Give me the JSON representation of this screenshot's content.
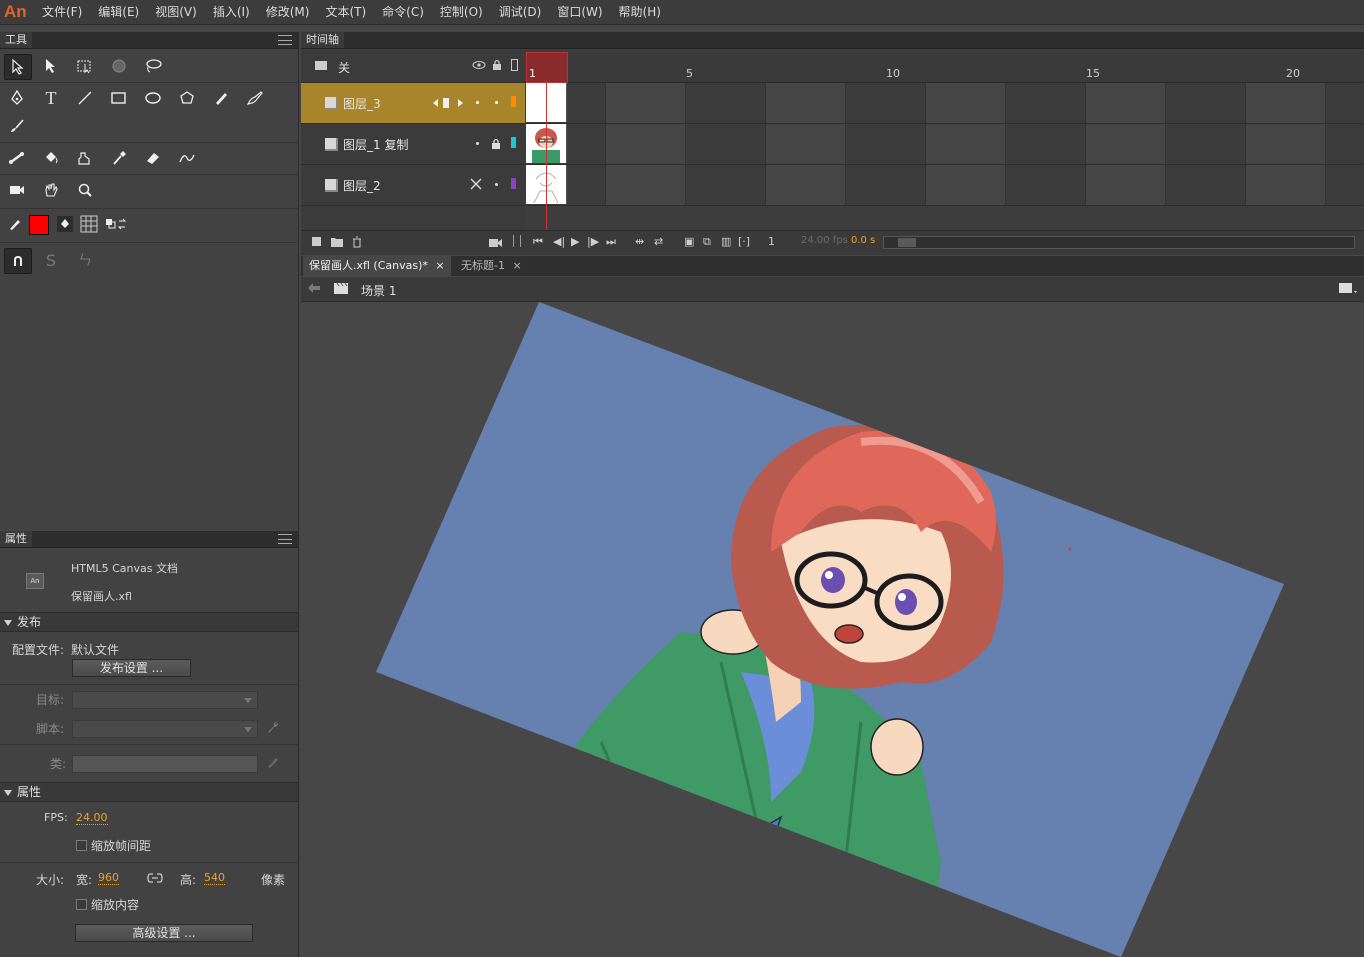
{
  "app": {
    "logo": "An"
  },
  "menu": [
    "文件(F)",
    "编辑(E)",
    "视图(V)",
    "插入(I)",
    "修改(M)",
    "文本(T)",
    "命令(C)",
    "控制(O)",
    "调试(D)",
    "窗口(W)",
    "帮助(H)"
  ],
  "tools_panel": {
    "title": "工具"
  },
  "colors": {
    "stroke": "#222222",
    "fill": "#ff0000",
    "accent": "#e8a427",
    "active_layer": "#a8842a",
    "stage_bg": "#6681b0"
  },
  "timeline": {
    "title": "时间轴",
    "header_row_label": "关",
    "ticks": [
      "1",
      "5",
      "10",
      "15",
      "20"
    ],
    "layers": [
      {
        "name": "图层_3",
        "active": true,
        "color": "#ff8c00"
      },
      {
        "name": "图层_1 复制",
        "active": false,
        "color": "#18c8d8"
      },
      {
        "name": "图层_2",
        "active": false,
        "color": "#8a3fc8"
      }
    ],
    "controls": {
      "current_frame": "1",
      "fps": "24.00 fps",
      "time": "0.0 s"
    }
  },
  "doc_tabs": [
    {
      "label": "保留画人.xfl (Canvas)*",
      "active": true
    },
    {
      "label": "无标题-1",
      "active": false
    }
  ],
  "edit_bar": {
    "scene": "场景 1"
  },
  "properties": {
    "title": "属性",
    "doc_type": "HTML5 Canvas 文档",
    "doc_icon": "An",
    "doc_name": "保留画人.xfl",
    "publish": {
      "header": "发布",
      "profile_label": "配置文件:",
      "profile_value": "默认文件",
      "settings_button": "发布设置 ...",
      "target_label": "目标:",
      "script_label": "脚本:",
      "class_label": "类:"
    },
    "props": {
      "header": "属性",
      "fps_label": "FPS:",
      "fps_value": "24.00",
      "scale_spans_label": "缩放帧间距",
      "size_label": "大小:",
      "width_label": "宽:",
      "width_value": "960",
      "height_label": "高:",
      "height_value": "540",
      "unit": "像素",
      "scale_content_label": "缩放内容",
      "advanced_button": "高级设置 ..."
    }
  }
}
